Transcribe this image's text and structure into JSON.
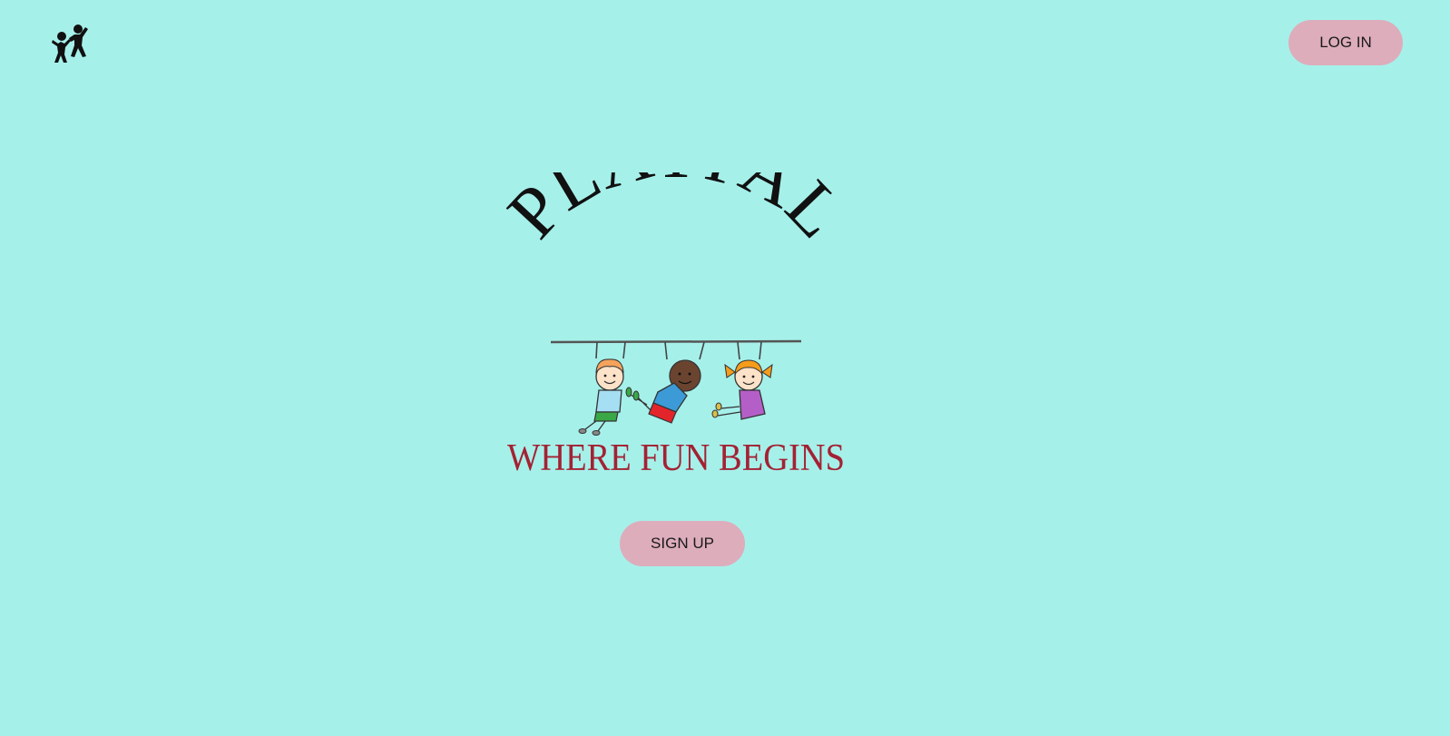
{
  "header": {
    "logo_icon": "two-kids-playing-icon",
    "login_label": "LOG IN"
  },
  "hero": {
    "brand_name": "PLAYPAL",
    "tagline": "WHERE FUN BEGINS",
    "illustration": "three-kids-hanging-from-bar",
    "signup_label": "SIGN UP"
  },
  "colors": {
    "background": "#a6f0ea",
    "button": "#ddadbb",
    "brand_text": "#111111",
    "tagline_text": "#a32233"
  }
}
